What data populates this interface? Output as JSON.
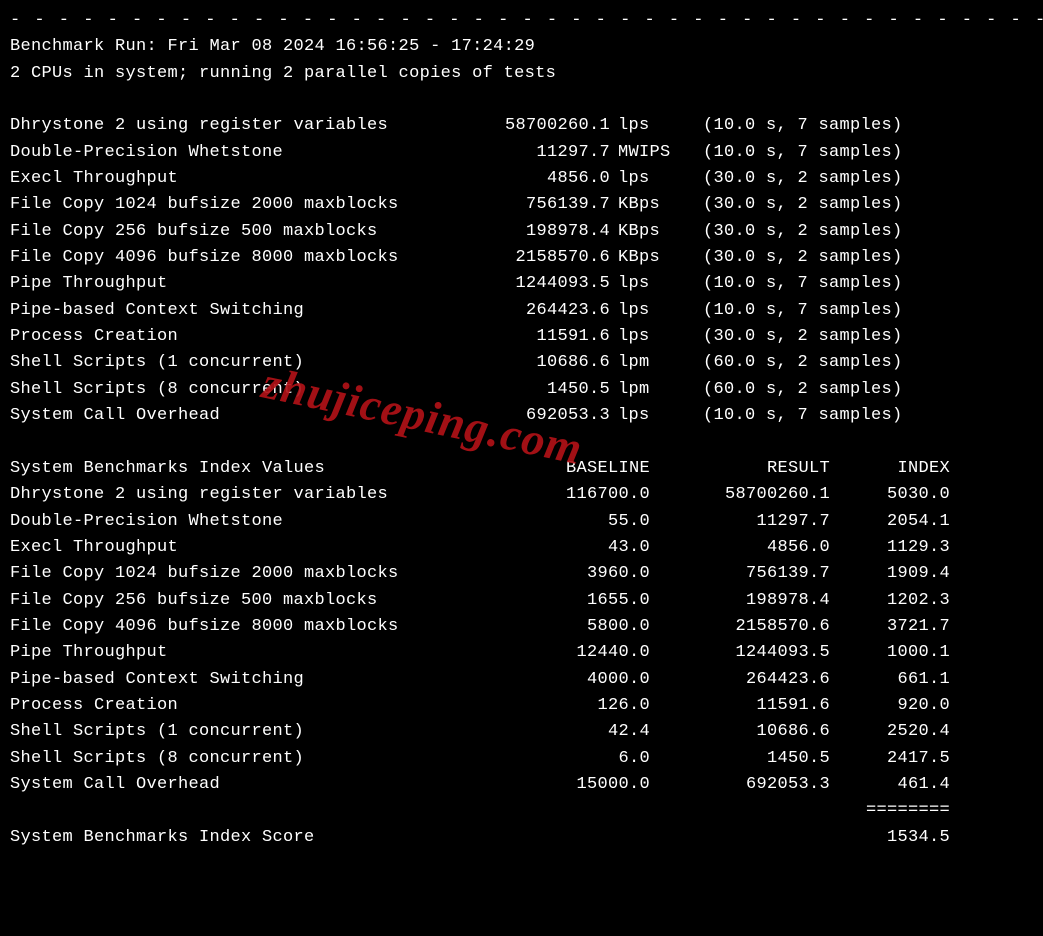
{
  "separator": "- - - - - - - - - - - - - - - - - - - - - - - - - - - - - - - - - - - - - - - - - - - - - - - - -",
  "header": {
    "run_line": "Benchmark Run: Fri Mar 08 2024 16:56:25 - 17:24:29",
    "cpu_line": "2 CPUs in system; running 2 parallel copies of tests"
  },
  "results": [
    {
      "name": "Dhrystone 2 using register variables",
      "value": "58700260.1",
      "unit": "lps",
      "paren": "(10.0 s, 7 samples)"
    },
    {
      "name": "Double-Precision Whetstone",
      "value": "11297.7",
      "unit": "MWIPS",
      "paren": "(10.0 s, 7 samples)"
    },
    {
      "name": "Execl Throughput",
      "value": "4856.0",
      "unit": "lps",
      "paren": "(30.0 s, 2 samples)"
    },
    {
      "name": "File Copy 1024 bufsize 2000 maxblocks",
      "value": "756139.7",
      "unit": "KBps",
      "paren": "(30.0 s, 2 samples)"
    },
    {
      "name": "File Copy 256 bufsize 500 maxblocks",
      "value": "198978.4",
      "unit": "KBps",
      "paren": "(30.0 s, 2 samples)"
    },
    {
      "name": "File Copy 4096 bufsize 8000 maxblocks",
      "value": "2158570.6",
      "unit": "KBps",
      "paren": "(30.0 s, 2 samples)"
    },
    {
      "name": "Pipe Throughput",
      "value": "1244093.5",
      "unit": "lps",
      "paren": "(10.0 s, 7 samples)"
    },
    {
      "name": "Pipe-based Context Switching",
      "value": "264423.6",
      "unit": "lps",
      "paren": "(10.0 s, 7 samples)"
    },
    {
      "name": "Process Creation",
      "value": "11591.6",
      "unit": "lps",
      "paren": "(30.0 s, 2 samples)"
    },
    {
      "name": "Shell Scripts (1 concurrent)",
      "value": "10686.6",
      "unit": "lpm",
      "paren": "(60.0 s, 2 samples)"
    },
    {
      "name": "Shell Scripts (8 concurrent)",
      "value": "1450.5",
      "unit": "lpm",
      "paren": "(60.0 s, 2 samples)"
    },
    {
      "name": "System Call Overhead",
      "value": "692053.3",
      "unit": "lps",
      "paren": "(10.0 s, 7 samples)"
    }
  ],
  "index_header": {
    "title": "System Benchmarks Index Values",
    "base": "BASELINE",
    "result": "RESULT",
    "index": "INDEX"
  },
  "index": [
    {
      "name": "Dhrystone 2 using register variables",
      "baseline": "116700.0",
      "result": "58700260.1",
      "index": "5030.0"
    },
    {
      "name": "Double-Precision Whetstone",
      "baseline": "55.0",
      "result": "11297.7",
      "index": "2054.1"
    },
    {
      "name": "Execl Throughput",
      "baseline": "43.0",
      "result": "4856.0",
      "index": "1129.3"
    },
    {
      "name": "File Copy 1024 bufsize 2000 maxblocks",
      "baseline": "3960.0",
      "result": "756139.7",
      "index": "1909.4"
    },
    {
      "name": "File Copy 256 bufsize 500 maxblocks",
      "baseline": "1655.0",
      "result": "198978.4",
      "index": "1202.3"
    },
    {
      "name": "File Copy 4096 bufsize 8000 maxblocks",
      "baseline": "5800.0",
      "result": "2158570.6",
      "index": "3721.7"
    },
    {
      "name": "Pipe Throughput",
      "baseline": "12440.0",
      "result": "1244093.5",
      "index": "1000.1"
    },
    {
      "name": "Pipe-based Context Switching",
      "baseline": "4000.0",
      "result": "264423.6",
      "index": "661.1"
    },
    {
      "name": "Process Creation",
      "baseline": "126.0",
      "result": "11591.6",
      "index": "920.0"
    },
    {
      "name": "Shell Scripts (1 concurrent)",
      "baseline": "42.4",
      "result": "10686.6",
      "index": "2520.4"
    },
    {
      "name": "Shell Scripts (8 concurrent)",
      "baseline": "6.0",
      "result": "1450.5",
      "index": "2417.5"
    },
    {
      "name": "System Call Overhead",
      "baseline": "15000.0",
      "result": "692053.3",
      "index": "461.4"
    }
  ],
  "eqline": "========",
  "score": {
    "label": "System Benchmarks Index Score",
    "value": "1534.5"
  },
  "watermark": "zhujiceping.com"
}
